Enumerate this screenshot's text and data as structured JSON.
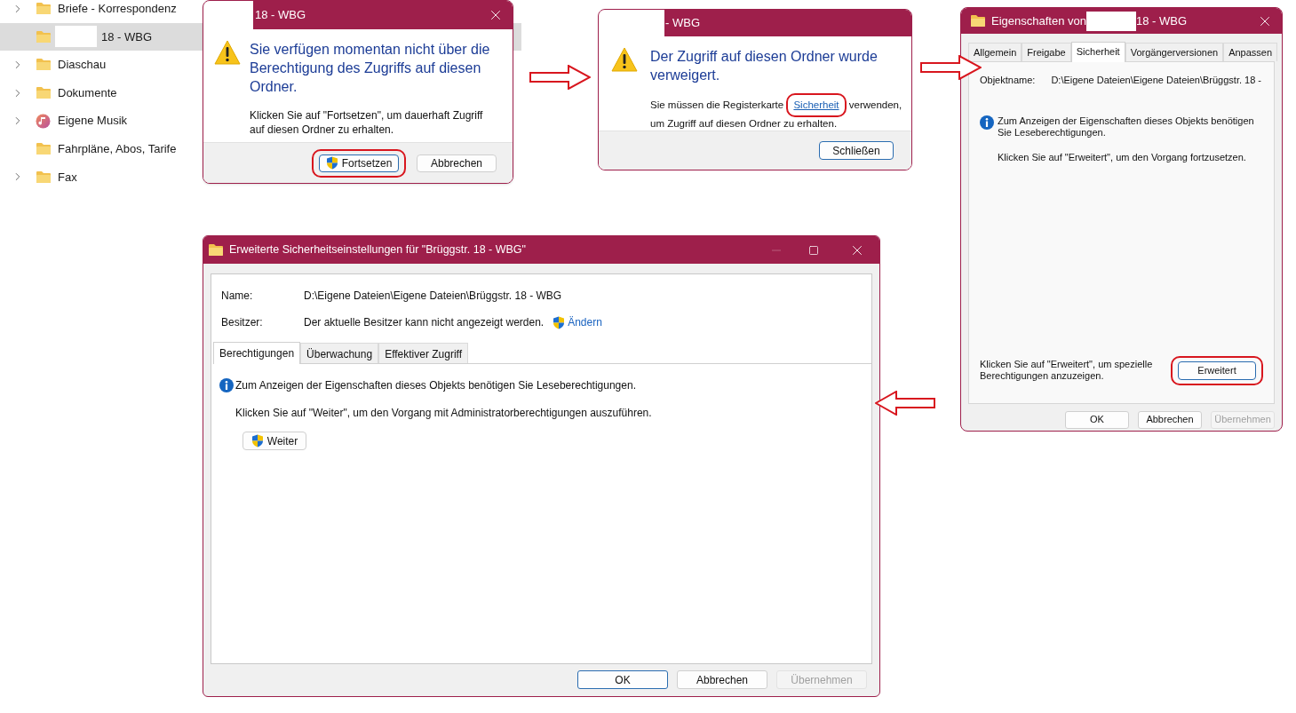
{
  "explorer": {
    "items": [
      {
        "label": "Briefe - Korrespondenz",
        "expandable": true,
        "selected": false,
        "kind": "folder"
      },
      {
        "label": "18 - WBG",
        "expandable": false,
        "selected": true,
        "kind": "folder"
      },
      {
        "label": "Diaschau",
        "expandable": true,
        "selected": false,
        "kind": "folder"
      },
      {
        "label": "Dokumente",
        "expandable": true,
        "selected": false,
        "kind": "folder"
      },
      {
        "label": "Eigene Musik",
        "expandable": true,
        "selected": false,
        "kind": "music"
      },
      {
        "label": "Fahrpläne, Abos, Tarife",
        "expandable": false,
        "selected": false,
        "kind": "folder"
      },
      {
        "label": "Fax",
        "expandable": true,
        "selected": false,
        "kind": "folder"
      }
    ]
  },
  "permission_dialog": {
    "title": "18 - WBG",
    "heading": "Sie verfügen momentan nicht über die Berechtigung des Zugriffs auf diesen Ordner.",
    "message": "Klicken Sie auf \"Fortsetzen\", um dauerhaft Zugriff auf diesen Ordner zu erhalten.",
    "buttons": [
      {
        "label": "Fortsetzen",
        "shield": true,
        "default": true,
        "highlighted": true
      },
      {
        "label": "Abbrechen",
        "shield": false,
        "default": false,
        "highlighted": false
      }
    ]
  },
  "denied_dialog": {
    "title": "- WBG",
    "heading": "Der Zugriff auf diesen Ordner wurde verweigert.",
    "message_before": "Sie müssen die Registerkarte ",
    "link": "Sicherheit",
    "link_highlighted": true,
    "message_after": " verwenden, um Zugriff auf diesen Ordner zu erhalten.",
    "buttons": [
      {
        "label": "Schließen",
        "shield": false,
        "default": true,
        "highlighted": false
      }
    ]
  },
  "properties_dialog": {
    "title_start": "Eigenschaften von",
    "title_end": "18 - WBG",
    "tabs": [
      {
        "label": "Allgemein",
        "selected": false
      },
      {
        "label": "Freigabe",
        "selected": false
      },
      {
        "label": "Sicherheit",
        "selected": true
      },
      {
        "label": "Vorgängerversionen",
        "selected": false
      },
      {
        "label": "Anpassen",
        "selected": false
      }
    ],
    "object_label": "Objektname:",
    "object_value": "D:\\Eigene Dateien\\Eigene Dateien\\Brüggstr. 18 -",
    "info": "Zum Anzeigen der Eigenschaften dieses Objekts benötigen Sie Leseberechtigungen.",
    "hint": "Klicken Sie auf \"Erweitert\", um den Vorgang fortzusetzen.",
    "advanced_text": "Klicken Sie auf \"Erweitert\", um spezielle Berechtigungen anzuzeigen.",
    "advanced_button": {
      "label": "Erweitert",
      "shield": false,
      "default": true,
      "highlighted": true
    },
    "buttons": [
      {
        "label": "OK",
        "disabled": false
      },
      {
        "label": "Abbrechen",
        "disabled": false
      },
      {
        "label": "Übernehmen",
        "disabled": true
      }
    ]
  },
  "advanced_dialog": {
    "title": "Erweiterte Sicherheitseinstellungen für \"Brüggstr. 18 - WBG\"",
    "name_label": "Name:",
    "name_value": "D:\\Eigene Dateien\\Eigene Dateien\\Brüggstr. 18 - WBG",
    "owner_label": "Besitzer:",
    "owner_value": "Der aktuelle Besitzer kann nicht angezeigt werden.",
    "change_link": "Ändern",
    "tabs": [
      {
        "label": "Berechtigungen",
        "selected": true
      },
      {
        "label": "Überwachung",
        "selected": false
      },
      {
        "label": "Effektiver Zugriff",
        "selected": false
      }
    ],
    "info": "Zum Anzeigen der Eigenschaften dieses Objekts benötigen Sie Leseberechtigungen.",
    "hint": "Klicken Sie auf \"Weiter\", um den Vorgang mit Administratorberechtigungen auszuführen.",
    "continue_button": {
      "label": "Weiter",
      "shield": true,
      "default": false,
      "highlighted": false
    },
    "buttons": [
      {
        "label": "OK",
        "disabled": false,
        "default": true
      },
      {
        "label": "Abbrechen",
        "disabled": false,
        "default": false
      },
      {
        "label": "Übernehmen",
        "disabled": true,
        "default": false
      }
    ]
  },
  "arrows": [
    {
      "kind": "right"
    },
    {
      "kind": "right"
    },
    {
      "kind": "left"
    }
  ]
}
